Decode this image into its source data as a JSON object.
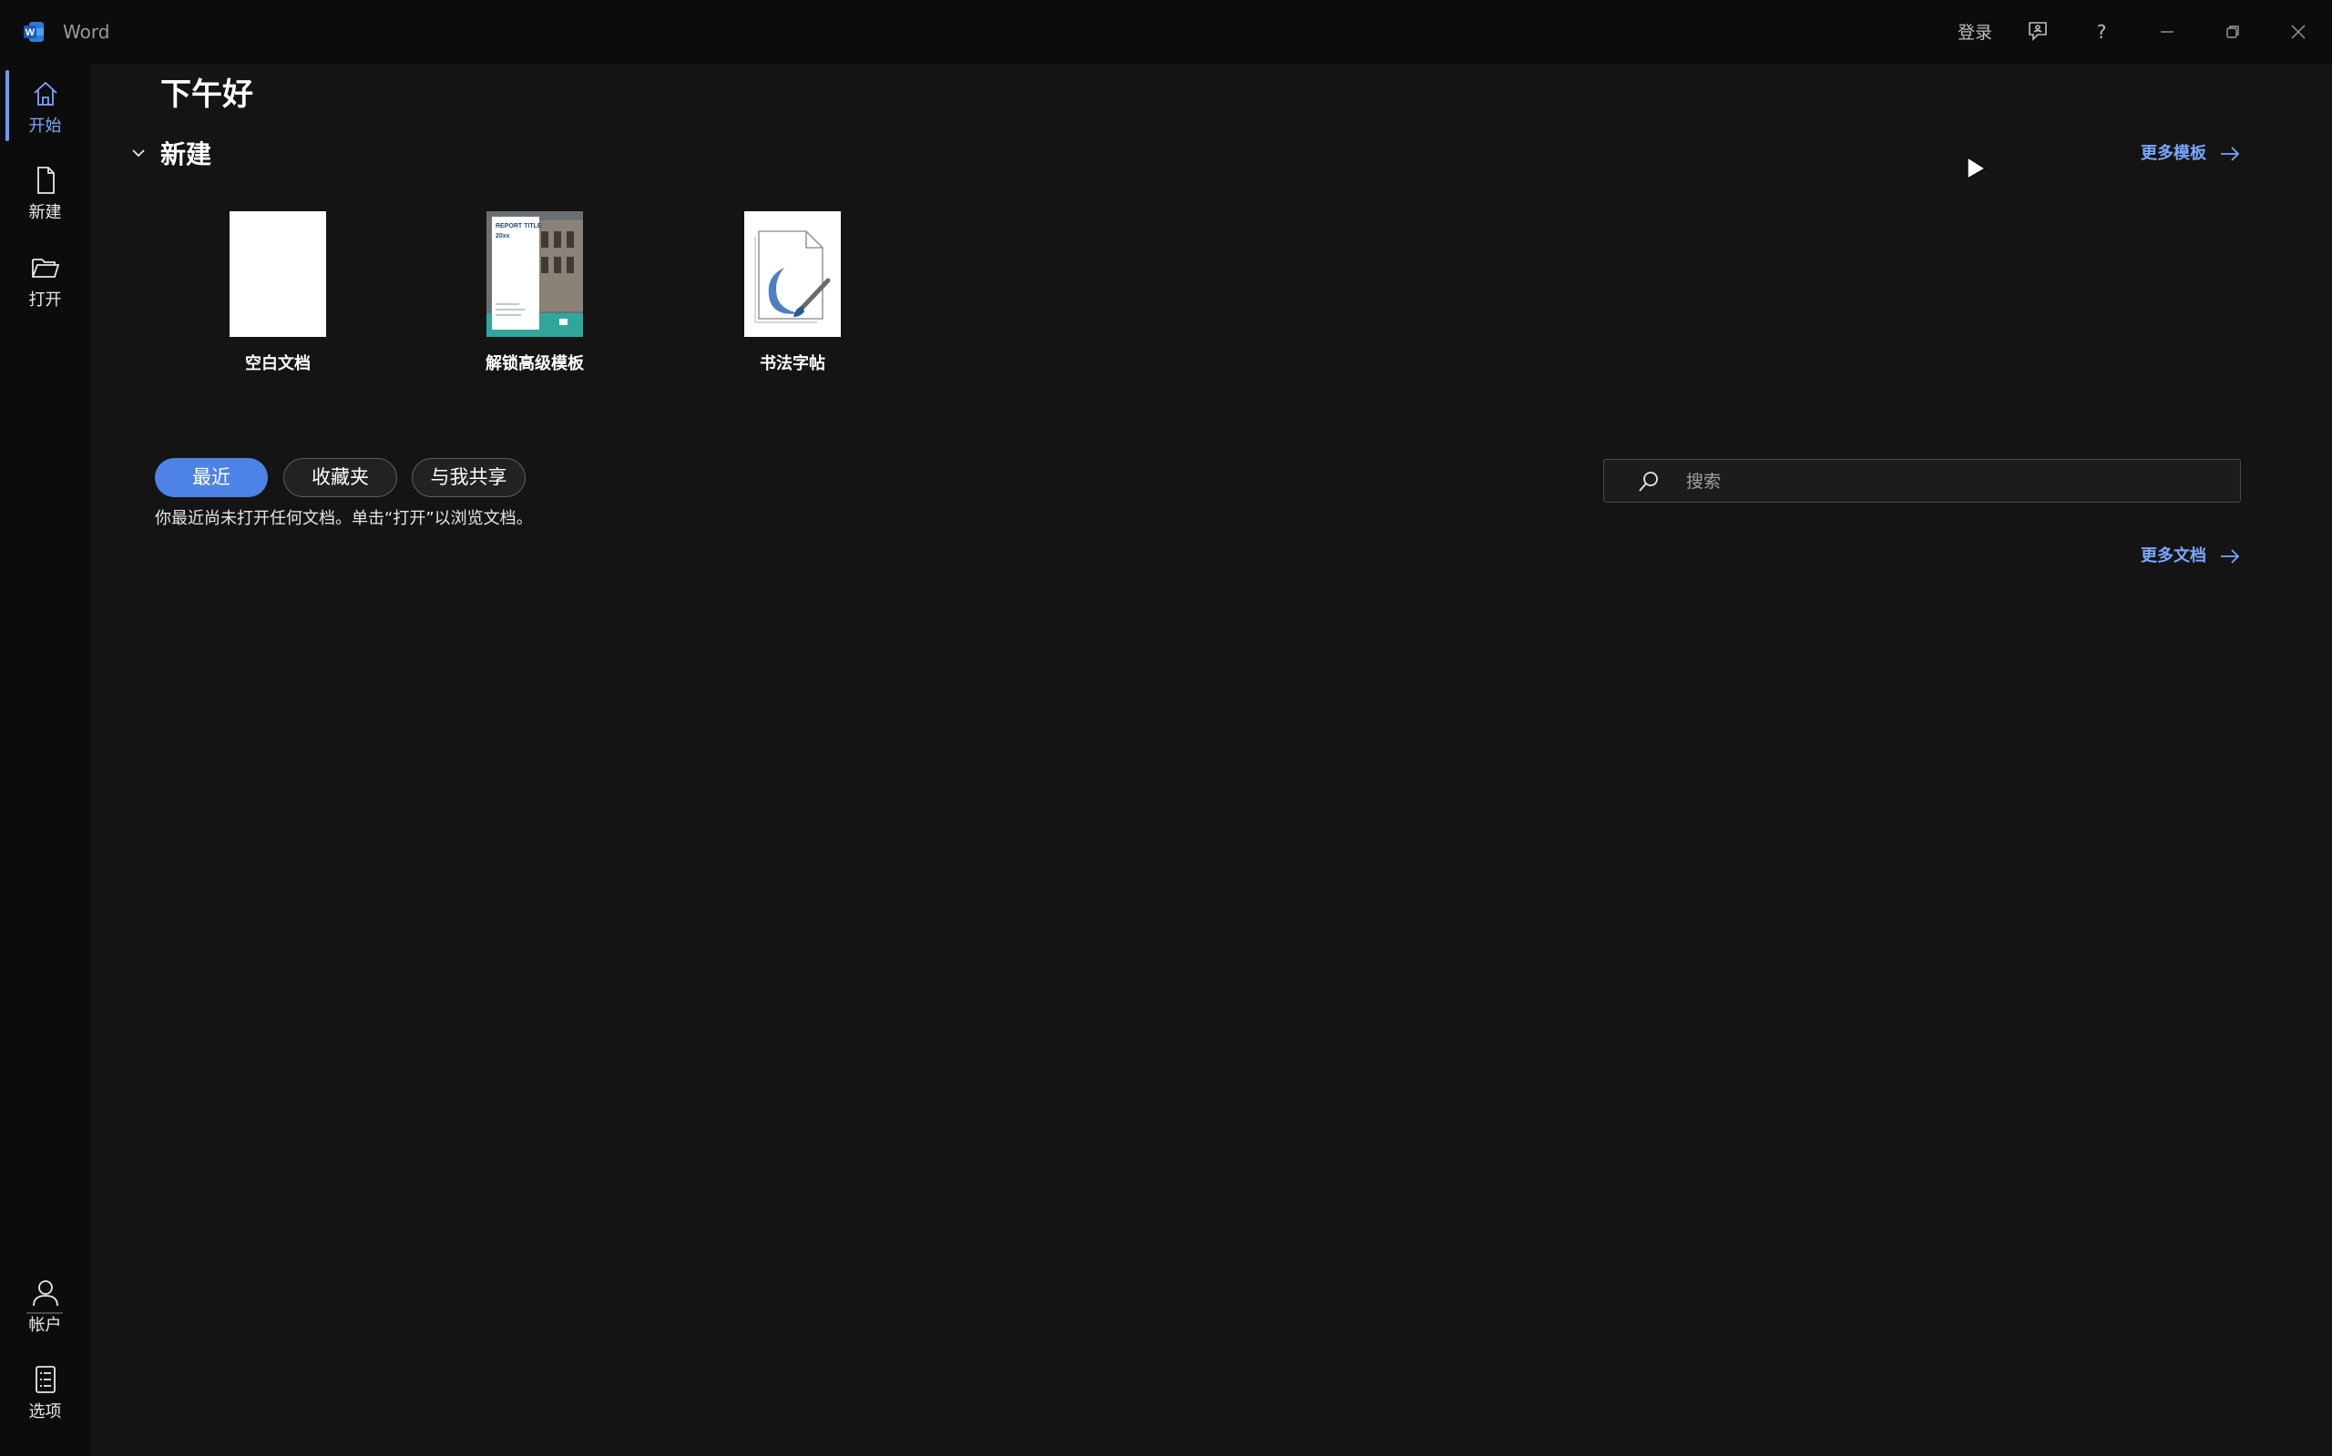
{
  "window": {
    "app_name": "Word",
    "sign_in": "登录"
  },
  "sidebar": {
    "items": [
      {
        "label": "开始",
        "icon": "home-icon",
        "active": true
      },
      {
        "label": "新建",
        "icon": "new-document-icon"
      },
      {
        "label": "打开",
        "icon": "folder-open-icon"
      }
    ],
    "bottom_items": [
      {
        "label": "帐户",
        "icon": "account-icon"
      },
      {
        "label": "选项",
        "icon": "options-icon"
      }
    ]
  },
  "main": {
    "greeting": "下午好",
    "new_section": {
      "title": "新建",
      "more_templates": "更多模板",
      "templates": [
        {
          "label": "空白文档"
        },
        {
          "label": "解锁高级模板",
          "thumb_title": "REPORT TITLE",
          "thumb_year": "20xx"
        },
        {
          "label": "书法字帖"
        }
      ]
    },
    "tabs": [
      {
        "label": "最近",
        "active": true
      },
      {
        "label": "收藏夹"
      },
      {
        "label": "与我共享"
      }
    ],
    "empty_message": "你最近尚未打开任何文档。单击“打开”以浏览文档。",
    "search": {
      "placeholder": "搜索"
    },
    "more_documents": "更多文档"
  },
  "colors": {
    "accent": "#4d82e6",
    "link": "#7aa7ff",
    "background": "#141414",
    "chrome": "#0c0c0c"
  }
}
